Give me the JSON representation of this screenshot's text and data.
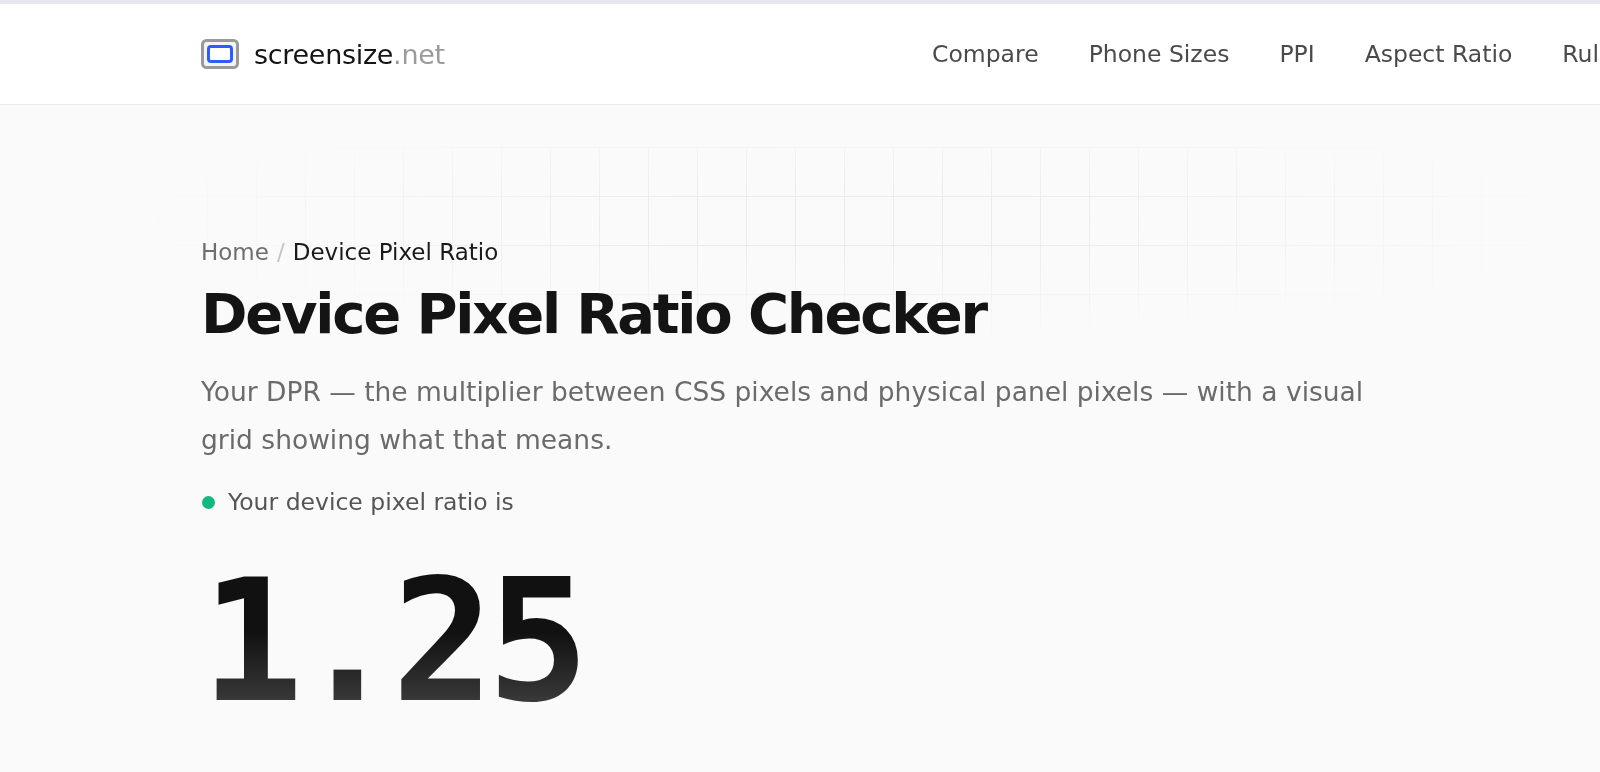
{
  "header": {
    "logo": {
      "name": "screensize",
      "suffix": ".net"
    },
    "nav": [
      {
        "label": "Compare"
      },
      {
        "label": "Phone Sizes"
      },
      {
        "label": "PPI"
      },
      {
        "label": "Aspect Ratio"
      },
      {
        "label": "Rul"
      }
    ]
  },
  "breadcrumb": {
    "separator": "/",
    "items": [
      {
        "label": "Home",
        "current": false
      },
      {
        "label": "Device Pixel Ratio",
        "current": true
      }
    ]
  },
  "title": "Device Pixel Ratio Checker",
  "description": "Your DPR — the multiplier between CSS pixels and physical panel pixels — with a visual grid showing what that means.",
  "status": {
    "label": "Your device pixel ratio is",
    "color": "#10b981"
  },
  "dpr": "1.25"
}
